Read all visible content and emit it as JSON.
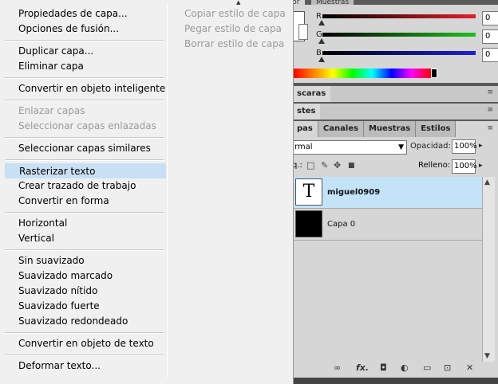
{
  "context_menu": {
    "left_items": [
      {
        "label": "Propiedades de capa...",
        "disabled": false
      },
      {
        "label": "Opciones de fusión...",
        "disabled": false
      },
      {
        "label": "Duplicar capa...",
        "disabled": false
      },
      {
        "label": "Eliminar capa",
        "disabled": false
      },
      {
        "label": "Convertir en objeto inteligente",
        "disabled": false
      },
      {
        "label": "Enlazar capas",
        "disabled": true
      },
      {
        "label": "Seleccionar capas enlazadas",
        "disabled": true
      },
      {
        "label": "Seleccionar capas similares",
        "disabled": false
      },
      {
        "label": "Rasterizar texto",
        "disabled": false,
        "highlighted": true
      },
      {
        "label": "Crear trazado de trabajo",
        "disabled": false
      },
      {
        "label": "Convertir en forma",
        "disabled": false
      },
      {
        "label": "Horizontal",
        "disabled": false
      },
      {
        "label": "Vertical",
        "disabled": false
      },
      {
        "label": "Sin suavizado",
        "disabled": false
      },
      {
        "label": "Suavizado marcado",
        "disabled": false
      },
      {
        "label": "Suavizado nítido",
        "disabled": false
      },
      {
        "label": "Suavizado fuerte",
        "disabled": false
      },
      {
        "label": "Suavizado redondeado",
        "disabled": false
      },
      {
        "label": "Convertir en objeto de texto",
        "disabled": false
      },
      {
        "label": "Deformar texto...",
        "disabled": false
      }
    ],
    "right_items": [
      {
        "label": "Copiar estilo de capa",
        "disabled": true
      },
      {
        "label": "Pegar estilo de capa",
        "disabled": true
      },
      {
        "label": "Borrar estilo de capa",
        "disabled": true
      }
    ]
  },
  "color_panel": {
    "tabs": [
      "Color",
      "Muestras"
    ],
    "channels": [
      {
        "label": "R",
        "value": "0",
        "color": "#e0202a"
      },
      {
        "label": "G",
        "value": "0",
        "color": "#20c020"
      },
      {
        "label": "B",
        "value": "0",
        "color": "#2020d8"
      }
    ]
  },
  "collapsed_panels": [
    {
      "label": "scaras"
    },
    {
      "label": "stes"
    }
  ],
  "layers_panel": {
    "tabs": [
      {
        "label": "pas",
        "active": true
      },
      {
        "label": "Canales",
        "active": false
      },
      {
        "label": "Muestras",
        "active": false
      },
      {
        "label": "Estilos",
        "active": false
      }
    ],
    "blend_mode": "rmal",
    "opacity_label": "Opacidad:",
    "opacity_value": "100%",
    "lock_label": "q.:",
    "fill_label": "Relleno:",
    "fill_value": "100%",
    "layers": [
      {
        "name": "miguel0909",
        "thumb": "T",
        "selected": true
      },
      {
        "name": "Capa 0",
        "thumb": "",
        "selected": false
      }
    ]
  },
  "icons": {
    "panel_menu": "≡",
    "dropdown_arrow": "▼",
    "lock_icons": [
      "□",
      "✎",
      "✥",
      "🔒"
    ],
    "bottom_icons": [
      "∞",
      "fx.",
      "◘",
      "◐",
      "▭",
      "⊡",
      "🗑"
    ]
  }
}
